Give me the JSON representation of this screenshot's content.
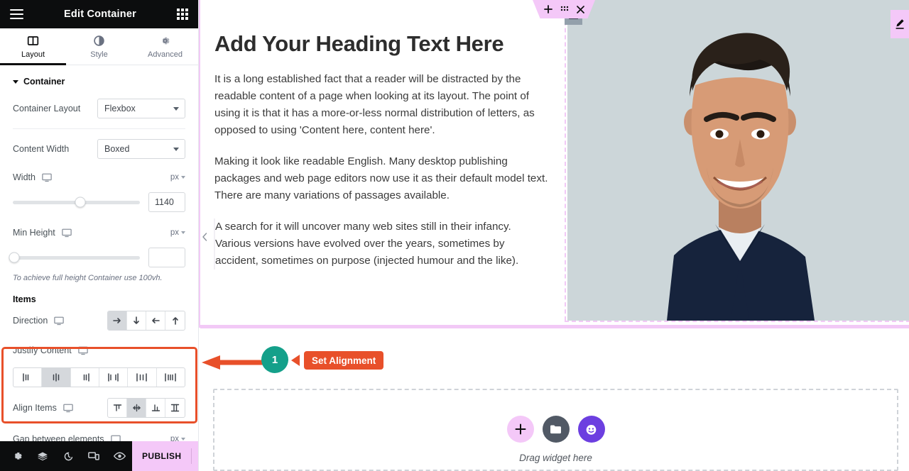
{
  "panel": {
    "header": {
      "title": "Edit Container",
      "menu_icon": "hamburger-icon",
      "apps_icon": "grid-apps-icon"
    },
    "tabs": [
      {
        "id": "layout",
        "label": "Layout",
        "icon": "layout-columns-icon",
        "active": true
      },
      {
        "id": "style",
        "label": "Style",
        "icon": "contrast-half-circle-icon",
        "active": false
      },
      {
        "id": "advanced",
        "label": "Advanced",
        "icon": "gear-icon",
        "active": false
      }
    ],
    "section": {
      "title": "Container",
      "collapsed": false
    },
    "controls": {
      "container_layout": {
        "label": "Container Layout",
        "value": "Flexbox"
      },
      "content_width": {
        "label": "Content Width",
        "value": "Boxed"
      },
      "width": {
        "label": "Width",
        "unit": "px",
        "value": "1140",
        "slider_percent": 53,
        "device": "desktop"
      },
      "min_height": {
        "label": "Min Height",
        "unit": "px",
        "value": "",
        "slider_percent": 0,
        "device": "desktop"
      },
      "hint": "To achieve full height Container use 100vh.",
      "items_title": "Items",
      "direction": {
        "label": "Direction",
        "selected": 0,
        "options": [
          "row-arrow-right",
          "column-arrow-down",
          "row-reverse-arrow-left",
          "column-reverse-arrow-up"
        ]
      },
      "justify_content": {
        "label": "Justify Content",
        "selected": 1,
        "options": [
          "justify-start",
          "justify-center",
          "justify-end",
          "space-between",
          "space-around",
          "space-evenly"
        ]
      },
      "align_items": {
        "label": "Align Items",
        "selected": 1,
        "options": [
          "align-start",
          "align-center",
          "align-end",
          "align-stretch"
        ]
      },
      "gap": {
        "label": "Gap between elements",
        "unit": "px"
      }
    },
    "footer": {
      "icons": [
        "gear-icon",
        "layers-navigator-icon",
        "history-clock-icon",
        "responsive-devices-icon",
        "eye-preview-icon"
      ],
      "publish_label": "PUBLISH",
      "publish_chevron": "chevron-up-icon",
      "publish_color": "#f4c8f8"
    },
    "collapse_icon": "chevron-left-icon"
  },
  "canvas": {
    "toolbar": {
      "add_icon": "plus-icon",
      "drag_icon": "drag-dots-icon",
      "close_icon": "close-x-icon"
    },
    "edit_tab_icon": "pencil-edit-icon",
    "heading": "Add Your Heading Text Here",
    "paragraphs": [
      "It is a long established fact that a reader will be distracted by the readable content of a page when looking at its layout. The point of using it is that it has a more-or-less normal distribution of letters, as opposed to using 'Content here, content here'.",
      "Making it look like readable English. Many desktop publishing packages and web page editors now use it as their default model text. There are many variations of passages available.",
      "A search for it will uncover many web sites still in their infancy. Various versions have evolved over the years, sometimes by accident, sometimes on purpose (injected humour and the like)."
    ],
    "image_alt": "smiling-man-portrait",
    "drop_zone": {
      "label": "Drag widget here",
      "buttons": [
        {
          "name": "add-widget-button",
          "icon": "plus-icon",
          "color": "#f4c8f8"
        },
        {
          "name": "template-library-button",
          "icon": "folder-icon",
          "color": "#515965"
        },
        {
          "name": "ai-generate-button",
          "icon": "ai-face-icon",
          "color": "#6c3fe0"
        }
      ]
    }
  },
  "annotation": {
    "step_number": "1",
    "label": "Set Alignment",
    "badge_color": "#14a08a",
    "label_color": "#e8502a",
    "highlight_color": "#e8502a"
  }
}
